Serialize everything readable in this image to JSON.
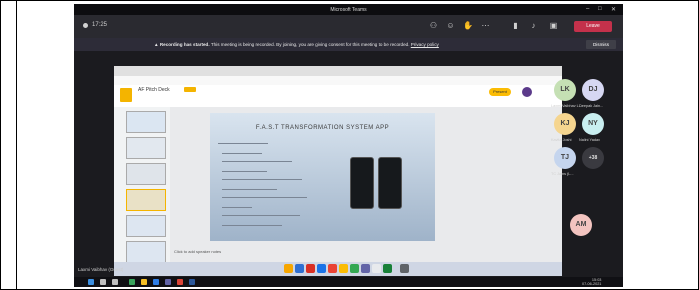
{
  "window": {
    "title": "Microsoft Teams",
    "minimize": "–",
    "maximize": "□",
    "close": "✕"
  },
  "toolbar": {
    "timer": "17:25",
    "leave_label": "Leave"
  },
  "banner": {
    "bold": "Recording has started.",
    "text": "This meeting is being recorded. By joining, you are giving consent for this meeting to be recorded.",
    "link": "Privacy policy",
    "dismiss_label": "Dismiss"
  },
  "shared_screen": {
    "doc_title": "AF Pitch Deck",
    "present_label": "Present",
    "slide_title": "F.A.S.T TRANSFORMATION SYSTEM APP",
    "speaker_notes_placeholder": "Click to add speaker notes",
    "presenter": "Laxmi Vaibhav (Guest)"
  },
  "participants": [
    {
      "initials": "LK",
      "name": "Laxmi Vaibhav L...",
      "color": "#c5e0b4"
    },
    {
      "initials": "DJ",
      "name": "Deepak Jain...",
      "color": "#d6d7f2"
    },
    {
      "initials": "KJ",
      "name": "Kavita Joshi",
      "color": "#f5d58f"
    },
    {
      "initials": "NY",
      "name": "Nalini Yadav",
      "color": "#c9eef0"
    },
    {
      "initials": "TJ",
      "name": "TC Jains (L...",
      "color": "#c5d5ee"
    },
    {
      "initials": "+38",
      "name": "",
      "color": "#3a3a40"
    },
    {
      "initials": "AM",
      "name": "",
      "color": "#f3c4c0"
    }
  ],
  "clock": {
    "time": "15:03",
    "date": "07-06-2021"
  }
}
